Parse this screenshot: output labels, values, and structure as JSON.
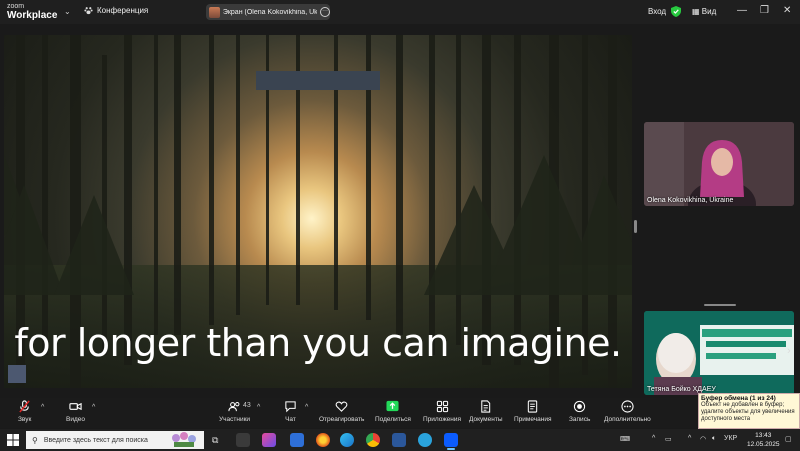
{
  "titlebar": {
    "brand_top": "zoom",
    "brand_bottom": "Workplace",
    "conference_label": "Конференция",
    "screen_share_label": "Экран (Olena Kokovikhina, Ukrai",
    "signin_label": "Вход",
    "view_label": "Вид"
  },
  "share": {
    "caption": "for longer than you can imagine."
  },
  "videos": [
    {
      "name": "Olena Kokovikhina, Ukraine"
    },
    {
      "name": "Тетяна Бойко ХДАЕУ"
    }
  ],
  "toolbar": {
    "audio": "Звук",
    "video": "Видео",
    "participants": "Участники",
    "participants_count": "43",
    "chat": "Чат",
    "react": "Отреагировать",
    "share": "Поделиться",
    "apps": "Приложения",
    "docs": "Документы",
    "notes": "Примечания",
    "record": "Запись",
    "more": "Дополнительно"
  },
  "clipboard": {
    "title": "Буфер обмена (1 из 24)",
    "body": "Объект не добавлен в буфер; удалите объекты для увеличения доступного места"
  },
  "taskbar": {
    "search_placeholder": "Введите здесь текст для поиска",
    "lang": "УКР",
    "time": "13:43",
    "date": "12.05.2025"
  },
  "colors": {
    "zoom_blue": "#0b5cff",
    "share_green": "#23d959",
    "shield_green": "#27c93f"
  }
}
